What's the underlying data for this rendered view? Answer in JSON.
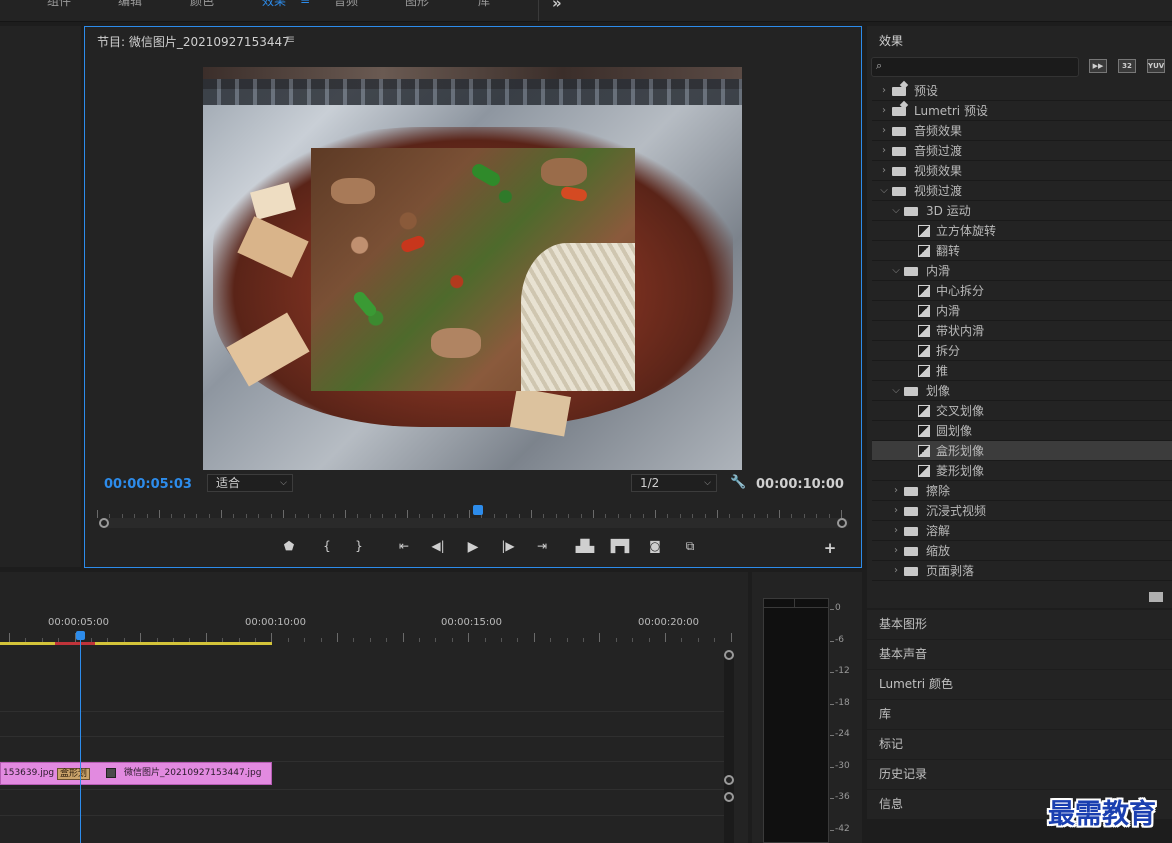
{
  "workspace_tabs": [
    {
      "label": "组件",
      "active": false
    },
    {
      "label": "编辑",
      "active": false
    },
    {
      "label": "颜色",
      "active": false
    },
    {
      "label": "效果",
      "active": true
    },
    {
      "label": "音频",
      "active": false
    },
    {
      "label": "图形",
      "active": false
    },
    {
      "label": "库",
      "active": false
    }
  ],
  "workspace_menu_icon": "≡",
  "workspace_more": "»",
  "program_monitor": {
    "title": "节目: 微信图片_20210927153447",
    "menu_icon": "≡",
    "timecode_current": "00:00:05:03",
    "fit_value": "适合",
    "resolution_value": "1/2",
    "timecode_duration": "00:00:10:00",
    "playhead_fraction": 0.5
  },
  "transport_icons": [
    "add-marker-icon",
    "mark-in-icon",
    "mark-out-icon",
    "go-to-in-icon",
    "step-back-icon",
    "play-icon",
    "step-forward-icon",
    "go-to-out-icon",
    "lift-icon",
    "extract-icon",
    "export-frame-icon",
    "comparison-view-icon",
    "add-button-icon"
  ],
  "effects": {
    "title": "效果",
    "search_value": "",
    "preset_buttons": [
      "32",
      "YUV"
    ],
    "tree": [
      {
        "label": "预设",
        "level": 0,
        "kind": "folder-star",
        "expanded": false
      },
      {
        "label": "Lumetri 预设",
        "level": 0,
        "kind": "folder-star",
        "expanded": false
      },
      {
        "label": "音频效果",
        "level": 0,
        "kind": "folder",
        "expanded": false
      },
      {
        "label": "音频过渡",
        "level": 0,
        "kind": "folder",
        "expanded": false
      },
      {
        "label": "视频效果",
        "level": 0,
        "kind": "folder",
        "expanded": false
      },
      {
        "label": "视频过渡",
        "level": 0,
        "kind": "folder",
        "expanded": true
      },
      {
        "label": "3D 运动",
        "level": 1,
        "kind": "folder",
        "expanded": true
      },
      {
        "label": "立方体旋转",
        "level": 2,
        "kind": "effect"
      },
      {
        "label": "翻转",
        "level": 2,
        "kind": "effect"
      },
      {
        "label": "内滑",
        "level": 1,
        "kind": "folder",
        "expanded": true
      },
      {
        "label": "中心拆分",
        "level": 2,
        "kind": "effect"
      },
      {
        "label": "内滑",
        "level": 2,
        "kind": "effect"
      },
      {
        "label": "带状内滑",
        "level": 2,
        "kind": "effect"
      },
      {
        "label": "拆分",
        "level": 2,
        "kind": "effect"
      },
      {
        "label": "推",
        "level": 2,
        "kind": "effect"
      },
      {
        "label": "划像",
        "level": 1,
        "kind": "folder",
        "expanded": true
      },
      {
        "label": "交叉划像",
        "level": 2,
        "kind": "effect"
      },
      {
        "label": "圆划像",
        "level": 2,
        "kind": "effect"
      },
      {
        "label": "盒形划像",
        "level": 2,
        "kind": "effect",
        "selected": true
      },
      {
        "label": "菱形划像",
        "level": 2,
        "kind": "effect"
      },
      {
        "label": "擦除",
        "level": 1,
        "kind": "folder",
        "expanded": false
      },
      {
        "label": "沉浸式视频",
        "level": 1,
        "kind": "folder",
        "expanded": false
      },
      {
        "label": "溶解",
        "level": 1,
        "kind": "folder",
        "expanded": false
      },
      {
        "label": "缩放",
        "level": 1,
        "kind": "folder",
        "expanded": false
      },
      {
        "label": "页面剥落",
        "level": 1,
        "kind": "folder",
        "expanded": false
      }
    ]
  },
  "side_panels": [
    "基本图形",
    "基本声音",
    "Lumetri 颜色",
    "库",
    "标记",
    "历史记录",
    "信息"
  ],
  "timeline": {
    "ruler_labels": [
      "00:00:05:00",
      "00:00:10:00",
      "00:00:15:00",
      "00:00:20:00"
    ],
    "clip_left_name": "153639.jpg",
    "transition_label": "盒形划",
    "clip_right_name": "微信图片_20210927153447.jpg"
  },
  "audio_meter_scale": [
    "0",
    "-6",
    "-12",
    "-18",
    "-24",
    "-30",
    "-36",
    "-42"
  ],
  "watermark": "最需教育",
  "colors": {
    "accent": "#2d8ceb",
    "clip": "#e28ae0",
    "panel": "#232323"
  }
}
